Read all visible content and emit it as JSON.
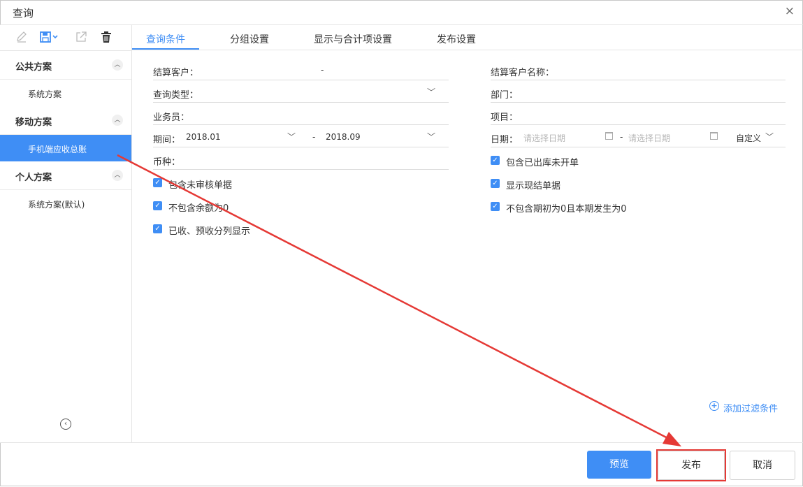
{
  "window": {
    "title": "查询",
    "close_glyph": "×"
  },
  "sidebar": {
    "groups": [
      {
        "label": "公共方案",
        "items": [
          {
            "label": "系统方案"
          }
        ]
      },
      {
        "label": "移动方案",
        "items": [
          {
            "label": "手机端应收总账",
            "active": true
          }
        ]
      },
      {
        "label": "个人方案",
        "items": [
          {
            "label": "系统方案(默认)"
          }
        ]
      }
    ],
    "tools": [
      "edit-icon",
      "save-icon",
      "export-icon",
      "delete-icon"
    ]
  },
  "tabs": [
    {
      "label": "查询条件",
      "active": true
    },
    {
      "label": "分组设置"
    },
    {
      "label": "显示与合计项设置"
    },
    {
      "label": "发布设置"
    }
  ],
  "form": {
    "left": {
      "settle_customer": {
        "label": "结算客户：",
        "range_sep": "-"
      },
      "query_type": {
        "label": "查询类型："
      },
      "salesman": {
        "label": "业务员："
      },
      "period": {
        "label": "期间：",
        "from": "2018.01",
        "sep": "-",
        "to": "2018.09"
      },
      "currency": {
        "label": "币种："
      }
    },
    "right": {
      "settle_customer_name": {
        "label": "结算客户名称："
      },
      "department": {
        "label": "部门："
      },
      "project": {
        "label": "项目："
      },
      "date": {
        "label": "日期：",
        "from_placeholder": "请选择日期",
        "sep": "-",
        "to_placeholder": "请选择日期",
        "mode": "自定义"
      }
    },
    "checkboxes_left": [
      {
        "label": "包含未审核单据",
        "checked": true
      },
      {
        "label": "不包含余额为0",
        "checked": true
      },
      {
        "label": "已收、预收分列显示",
        "checked": true
      }
    ],
    "checkboxes_right": [
      {
        "label": "包含已出库未开单",
        "checked": true
      },
      {
        "label": "显示现结单据",
        "checked": true
      },
      {
        "label": "不包含期初为0且本期发生为0",
        "checked": true
      }
    ],
    "add_filter": "添加过滤条件"
  },
  "footer": {
    "preview": "预览",
    "publish": "发布",
    "cancel": "取消"
  },
  "colors": {
    "accent": "#3f8ef5",
    "annotation": "#e53935"
  }
}
